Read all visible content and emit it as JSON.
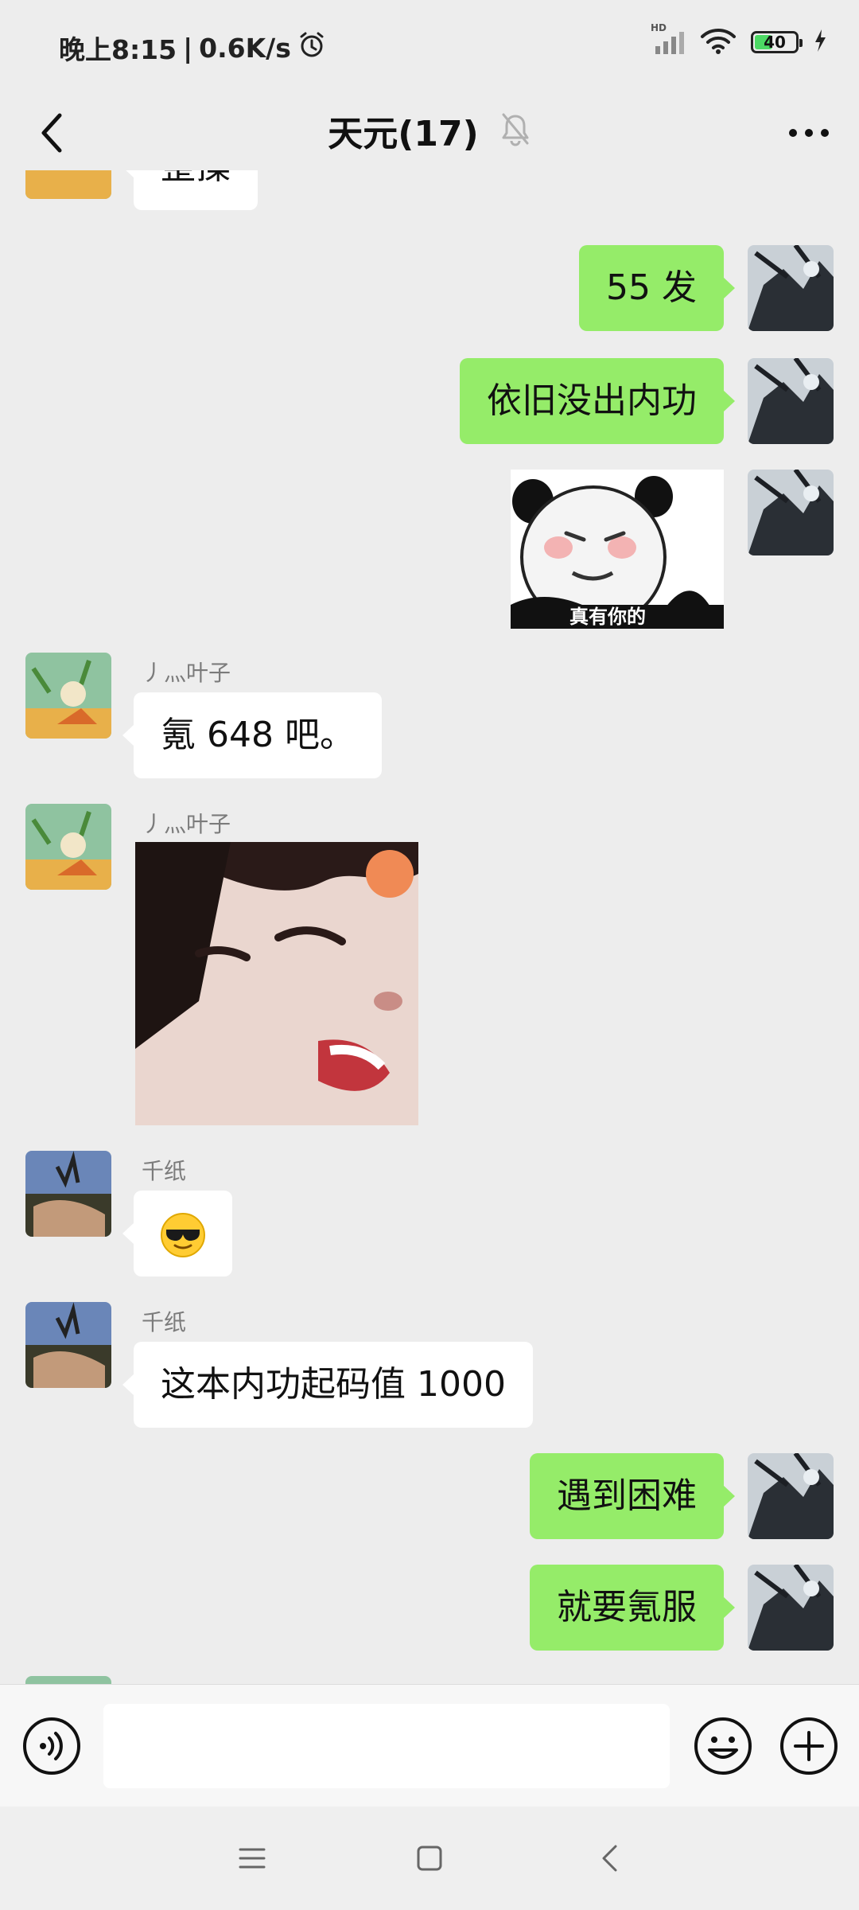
{
  "status_bar": {
    "time": "晚上8:15",
    "speed": "0.6K/s",
    "battery": "40",
    "battery_level": 0.4,
    "network_label": "HD"
  },
  "header": {
    "title": "天元(17)"
  },
  "messages": [
    {
      "side": "left",
      "type": "text",
      "text": "整操"
    },
    {
      "side": "right",
      "type": "text",
      "text": "55 发"
    },
    {
      "side": "right",
      "type": "text",
      "text": "依旧没出内功"
    },
    {
      "side": "right",
      "type": "sticker",
      "caption": "真有你的"
    },
    {
      "side": "left",
      "sender": "丿灬叶子",
      "type": "text",
      "text": "氪 648 吧。"
    },
    {
      "side": "left",
      "sender": "丿灬叶子",
      "type": "image"
    },
    {
      "side": "left",
      "sender": "千纸",
      "type": "emoji",
      "text": "😎"
    },
    {
      "side": "left",
      "sender": "千纸",
      "type": "text",
      "text": "这本内功起码值 1000"
    },
    {
      "side": "right",
      "type": "text",
      "text": "遇到困难"
    },
    {
      "side": "right",
      "type": "text",
      "text": "就要氪服"
    }
  ],
  "input": {
    "placeholder": ""
  },
  "colors": {
    "background": "#ededed",
    "bubble_self": "#95ec69",
    "bubble_other": "#ffffff"
  }
}
